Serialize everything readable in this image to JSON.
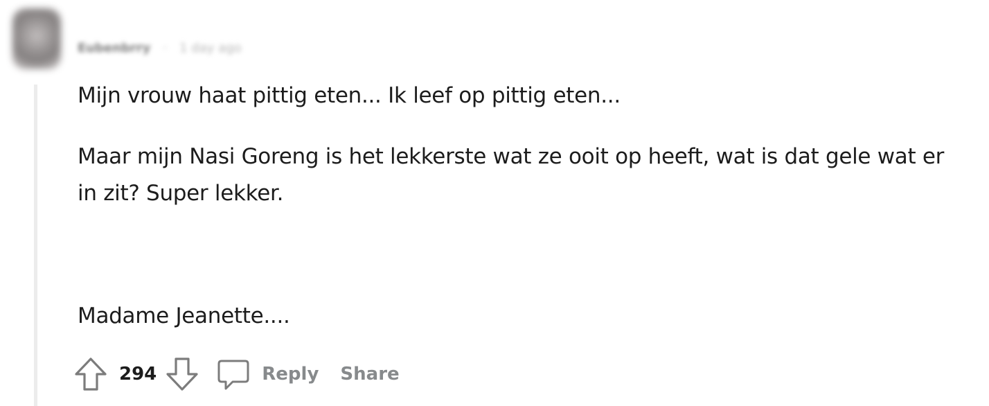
{
  "comment": {
    "author": "Eubenbrry",
    "time": "1 day ago",
    "separator": "·",
    "body": {
      "paragraph1": "Mijn vrouw haat pittig eten... Ik leef op pittig eten...",
      "paragraph2": "Maar mijn Nasi Goreng is het lekkerste wat ze ooit op heeft, wat is dat gele wat er in zit? Super lekker.",
      "paragraph3": "Madame Jeanette...."
    },
    "actions": {
      "score": "294",
      "reply_label": "Reply",
      "share_label": "Share",
      "upvote_icon": "arrow-up-outline-icon",
      "downvote_icon": "arrow-down-outline-icon",
      "comment_icon": "speech-bubble-icon"
    }
  },
  "colors": {
    "text": "#1c1c1c",
    "muted": "#878a8c",
    "thread_line": "#ececec"
  }
}
